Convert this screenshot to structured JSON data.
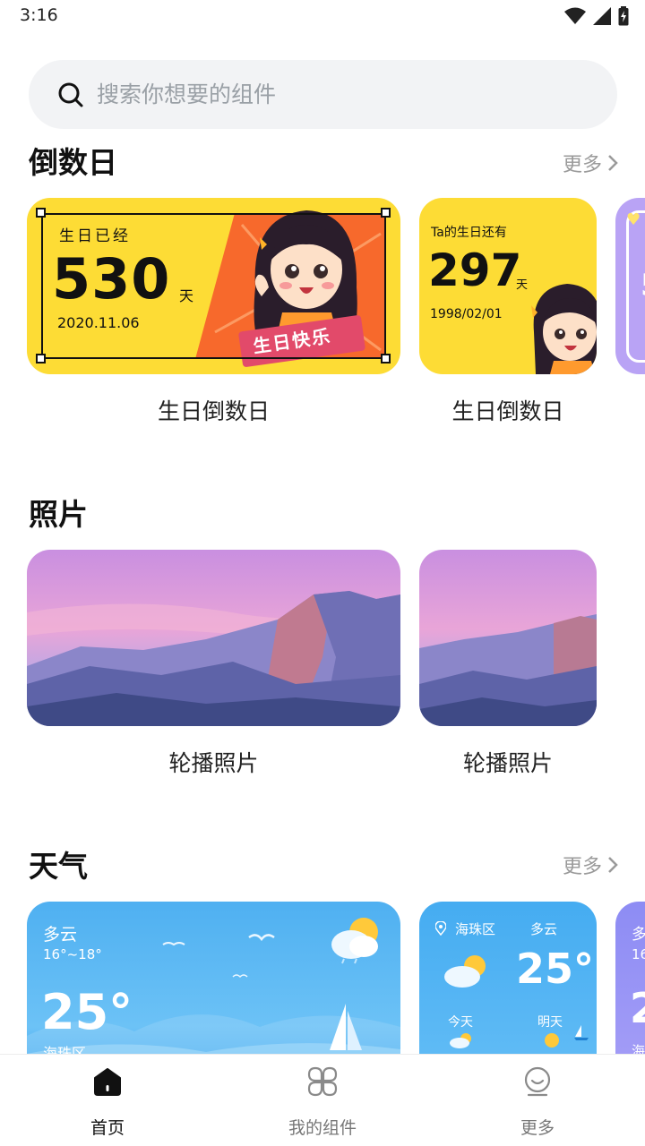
{
  "status_bar": {
    "time": "3:16"
  },
  "search": {
    "placeholder": "搜索你想要的组件"
  },
  "sections": {
    "countdown": {
      "title": "倒数日",
      "more": "更多"
    },
    "photos": {
      "title": "照片"
    },
    "weather": {
      "title": "天气",
      "more": "更多"
    }
  },
  "countdown_cards": [
    {
      "label": "生日已经",
      "number": "530",
      "unit": "天",
      "date": "2020.11.06",
      "sticker": "生日快乐",
      "caption": "生日倒数日"
    },
    {
      "label": "Ta的生日还有",
      "number": "297",
      "unit": "天",
      "date": "1998/02/01",
      "caption": "生日倒数日"
    }
  ],
  "photo_cards": [
    {
      "caption": "轮播照片"
    },
    {
      "caption": "轮播照片"
    }
  ],
  "weather_cards": [
    {
      "condition": "多云",
      "range": "16°~18°",
      "temp": "25°",
      "location": "海珠区"
    },
    {
      "location": "海珠区",
      "condition": "多云",
      "temp": "25°",
      "today": "今天",
      "tomorrow": "明天"
    }
  ],
  "peek_text": {
    "countdown_digit": "5",
    "weather_a": "多",
    "weather_b": "16",
    "weather_c": "2",
    "weather_d": "海"
  },
  "bottom_nav": [
    {
      "label": "首页",
      "active": true
    },
    {
      "label": "我的组件",
      "active": false
    },
    {
      "label": "更多",
      "active": false
    }
  ],
  "colors": {
    "yellow": "#fddc35",
    "sky_blue": "#4fb0f1",
    "purple": "#b9a3f5"
  }
}
